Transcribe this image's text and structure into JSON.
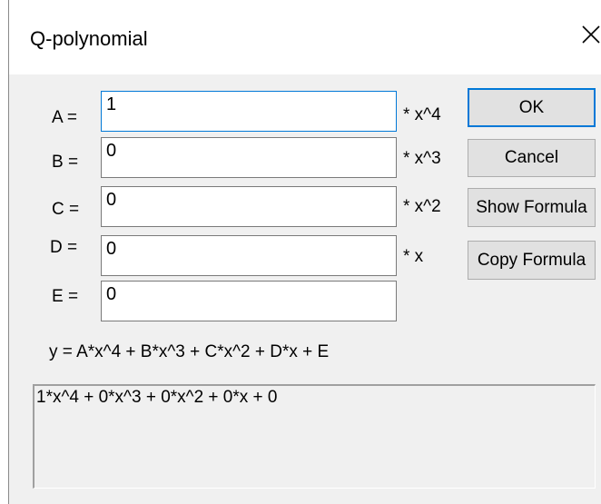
{
  "dialog": {
    "title": "Q-polynomial",
    "close_glyph": "×"
  },
  "coefficients": [
    {
      "label": "A =",
      "value": "1",
      "suffix": "* x^4"
    },
    {
      "label": "B =",
      "value": "0",
      "suffix": "* x^3"
    },
    {
      "label": "C =",
      "value": "0",
      "suffix": "* x^2"
    },
    {
      "label": "D =",
      "value": "0",
      "suffix": "* x"
    },
    {
      "label": "E =",
      "value": "0",
      "suffix": ""
    }
  ],
  "buttons": {
    "ok": "OK",
    "cancel": "Cancel",
    "show_formula": "Show Formula",
    "copy_formula": "Copy Formula"
  },
  "formula_template": "y =  A*x^4 + B*x^3 + C*x^2 + D*x + E",
  "formula_output": "1*x^4 + 0*x^3 + 0*x^2 + 0*x + 0",
  "colors": {
    "dialog_bg": "#f0f0f0",
    "focus_border": "#0078d7",
    "button_bg": "#e1e1e1"
  }
}
